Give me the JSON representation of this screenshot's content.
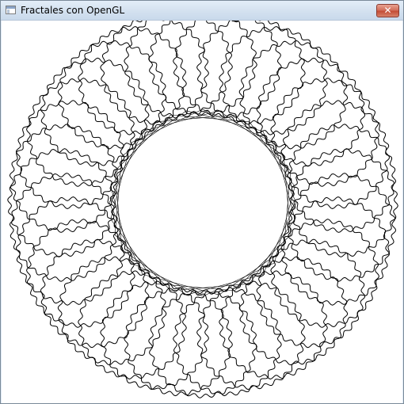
{
  "window": {
    "title": "Fractales con OpenGL",
    "close_symbol": "✕"
  },
  "icons": {
    "app": "window-app-icon",
    "close": "close-icon"
  },
  "colors": {
    "drawing": "#000000",
    "canvas_background": "#ffffff",
    "close_button": "#c44d36"
  },
  "fractal": {
    "type": "ring of circles",
    "circle_count": 36
  }
}
